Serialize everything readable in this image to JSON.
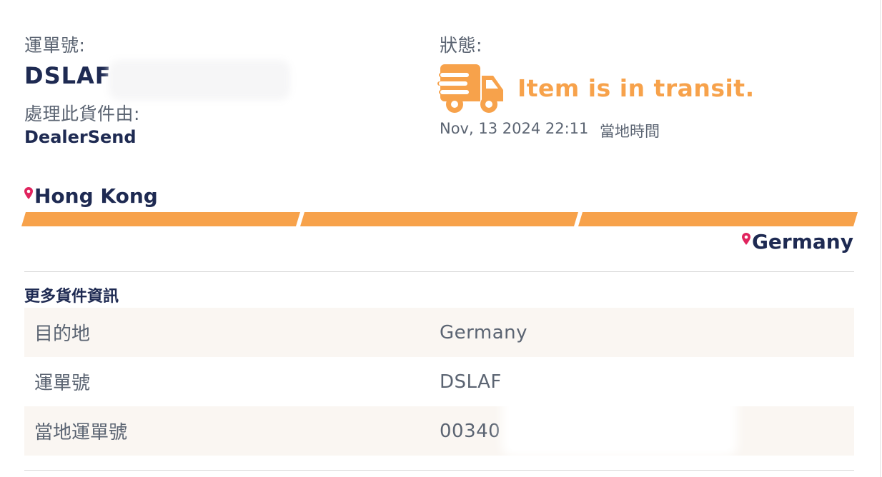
{
  "shipment": {
    "waybill_label": "運單號:",
    "waybill_number": "DSLAF",
    "handler_label": "處理此貨件由:",
    "handler_name": "DealerSend"
  },
  "status": {
    "label": "狀態:",
    "icon": "delivery-truck-icon",
    "text": "Item is in transit.",
    "datetime": "Nov, 13 2024 22:11",
    "timezone_note": "當地時間",
    "accent_color": "#f7a24b"
  },
  "route": {
    "origin": "Hong Kong",
    "destination": "Germany",
    "pin_icon": "location-pin-icon",
    "pin_color": "#e0245e",
    "bar_color": "#f7a24b"
  },
  "more_info": {
    "title": "更多貨件資訊",
    "rows": [
      {
        "key": "目的地",
        "value": "Germany"
      },
      {
        "key": "運單號",
        "value": "DSLAF"
      },
      {
        "key": "當地運單號",
        "value": "00340"
      }
    ]
  },
  "colors": {
    "navy": "#1e2a52",
    "gray_text": "#5b6472",
    "row_shade": "#faf6f2"
  }
}
